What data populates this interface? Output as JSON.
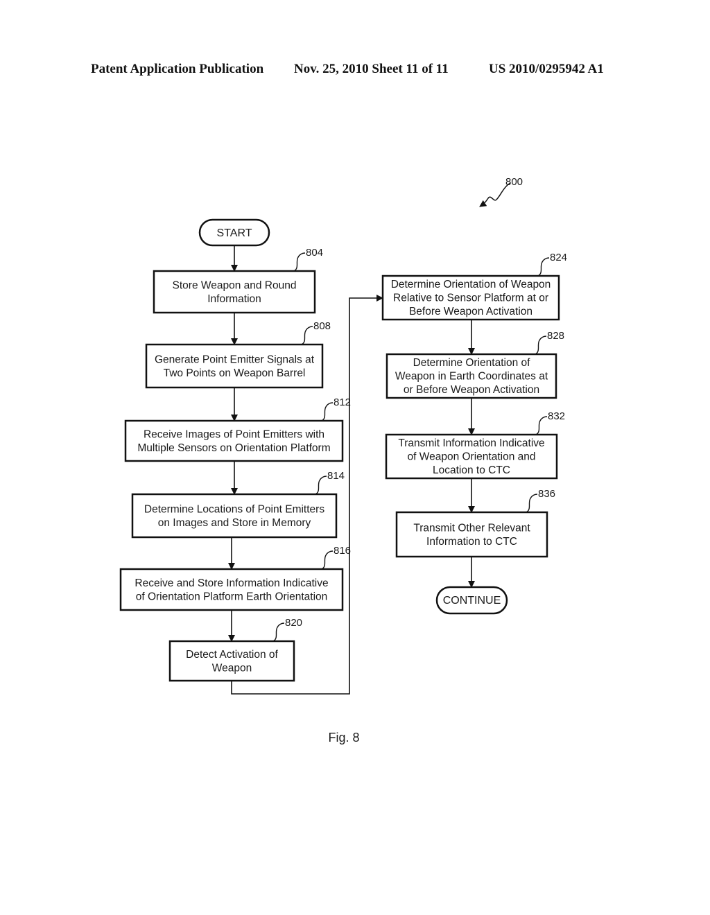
{
  "header": {
    "left": "Patent Application Publication",
    "middle": "Nov. 25, 2010  Sheet 11 of 11",
    "right": "US 2010/0295942 A1"
  },
  "figure": {
    "ref": "800",
    "caption": "Fig. 8"
  },
  "terminals": {
    "start": "START",
    "continue": "CONTINUE"
  },
  "steps": [
    {
      "id": "804",
      "lines": [
        "Store Weapon and Round",
        "Information"
      ]
    },
    {
      "id": "808",
      "lines": [
        "Generate Point Emitter Signals at",
        "Two Points on Weapon Barrel"
      ]
    },
    {
      "id": "812",
      "lines": [
        "Receive Images of Point Emitters with",
        "Multiple Sensors on Orientation Platform"
      ]
    },
    {
      "id": "814",
      "lines": [
        "Determine Locations of Point Emitters",
        "on Images and Store in Memory"
      ]
    },
    {
      "id": "816",
      "lines": [
        "Receive and Store Information Indicative",
        "of Orientation Platform Earth Orientation"
      ]
    },
    {
      "id": "820",
      "lines": [
        "Detect Activation of",
        "Weapon"
      ]
    },
    {
      "id": "824",
      "lines": [
        "Determine Orientation of Weapon",
        "Relative to Sensor Platform at or",
        "Before Weapon Activation"
      ]
    },
    {
      "id": "828",
      "lines": [
        "Determine Orientation of",
        "Weapon in Earth Coordinates at",
        "or Before Weapon Activation"
      ]
    },
    {
      "id": "832",
      "lines": [
        "Transmit Information Indicative",
        "of Weapon Orientation and",
        "Location to CTC"
      ]
    },
    {
      "id": "836",
      "lines": [
        "Transmit Other Relevant",
        "Information  to CTC"
      ]
    }
  ]
}
